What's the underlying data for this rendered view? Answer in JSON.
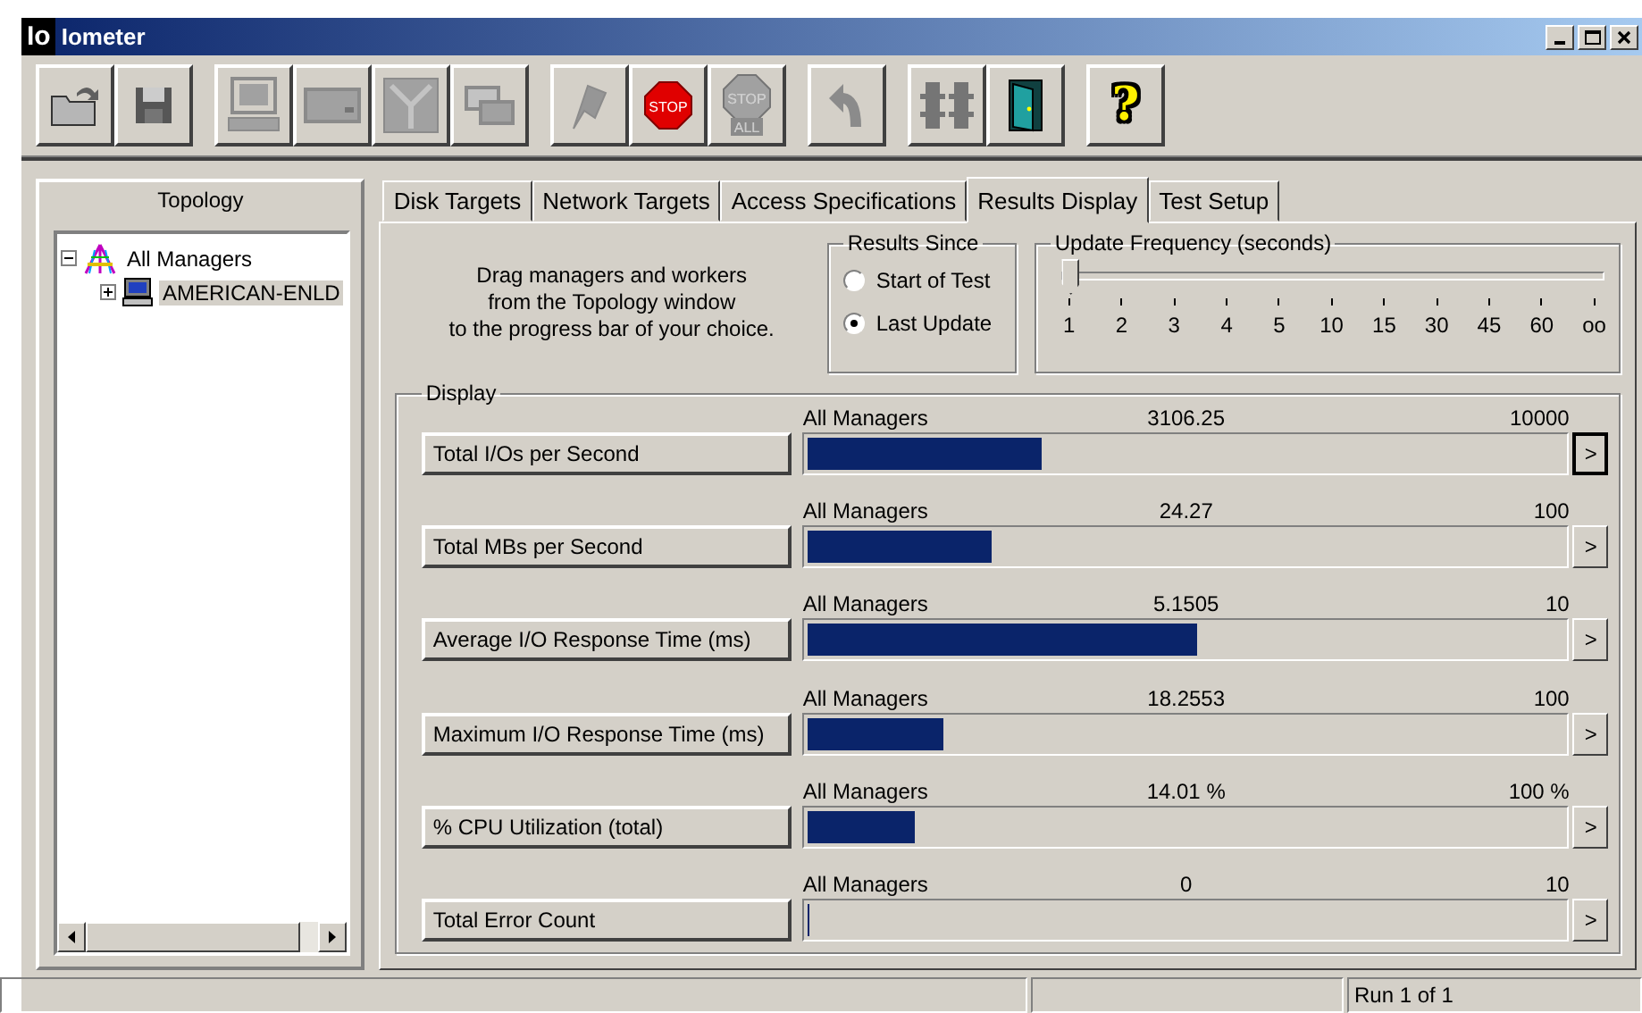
{
  "window": {
    "logo": "Io",
    "title": "Iometer"
  },
  "toolbar": [
    {
      "buttons": [
        {
          "kind": "open",
          "disabled": true
        },
        {
          "kind": "save",
          "disabled": true
        }
      ]
    },
    {
      "buttons": [
        {
          "kind": "computer",
          "disabled": true
        },
        {
          "kind": "disk",
          "disabled": true
        },
        {
          "kind": "network",
          "disabled": true
        },
        {
          "kind": "copy",
          "disabled": true
        }
      ]
    },
    {
      "buttons": [
        {
          "kind": "flag",
          "disabled": true
        },
        {
          "kind": "stop",
          "disabled": false,
          "text": [
            "STOP"
          ]
        },
        {
          "kind": "stop-all",
          "disabled": true,
          "text": [
            "STOP",
            "ALL"
          ]
        }
      ]
    },
    {
      "buttons": [
        {
          "kind": "reset",
          "disabled": true
        }
      ]
    },
    {
      "buttons": [
        {
          "kind": "workers",
          "disabled": true
        },
        {
          "kind": "exit",
          "disabled": false
        }
      ]
    },
    {
      "buttons": [
        {
          "kind": "help",
          "disabled": false,
          "text": [
            "?"
          ]
        }
      ]
    }
  ],
  "topology": {
    "title": "Topology",
    "tree": [
      {
        "label": "All Managers",
        "kind": "managers",
        "expanded": true,
        "selected": false,
        "children": [
          {
            "label": "AMERICAN-ENLD",
            "kind": "computer",
            "expanded": false,
            "selected": true
          }
        ]
      }
    ]
  },
  "tabs": [
    {
      "label": "Disk Targets",
      "selected": false
    },
    {
      "label": "Network Targets",
      "selected": false
    },
    {
      "label": "Access Specifications",
      "selected": false
    },
    {
      "label": "Results Display",
      "selected": true
    },
    {
      "label": "Test Setup",
      "selected": false
    }
  ],
  "instructions": [
    "Drag managers and workers",
    "from the Topology window",
    "to the progress bar of your choice."
  ],
  "results_since": {
    "title": "Results Since",
    "options": [
      {
        "label": "Start of Test",
        "selected": false
      },
      {
        "label": "Last Update",
        "selected": true
      }
    ]
  },
  "update_frequency": {
    "title": "Update Frequency (seconds)",
    "level": 0,
    "ticks": [
      "1",
      "2",
      "3",
      "4",
      "5",
      "10",
      "15",
      "30",
      "45",
      "60",
      "oo"
    ]
  },
  "display": {
    "title": "Display",
    "rows": [
      {
        "label": "Total I/Os per Second",
        "target": "All Managers",
        "value": "3106.25",
        "max": "10000",
        "level": 0.31,
        "more": ">",
        "focused": true
      },
      {
        "label": "Total MBs per Second",
        "target": "All Managers",
        "value": "24.27",
        "max": "100",
        "level": 0.243,
        "more": ">",
        "focused": false
      },
      {
        "label": "Average I/O Response Time (ms)",
        "target": "All Managers",
        "value": "5.1505",
        "max": "10",
        "level": 0.515,
        "more": ">",
        "focused": false
      },
      {
        "label": "Maximum I/O Response Time (ms)",
        "target": "All Managers",
        "value": "18.2553",
        "max": "100",
        "level": 0.18,
        "more": ">",
        "focused": false
      },
      {
        "label": "% CPU Utilization (total)",
        "target": "All Managers",
        "value": "14.01 %",
        "max": "100 %",
        "level": 0.14,
        "more": ">",
        "focused": false
      },
      {
        "label": "Total Error Count",
        "target": "All Managers",
        "value": "0",
        "max": "10",
        "level": 0,
        "more": ">",
        "focused": false
      }
    ]
  },
  "status_bar": {
    "text": "Run 1 of 1"
  }
}
